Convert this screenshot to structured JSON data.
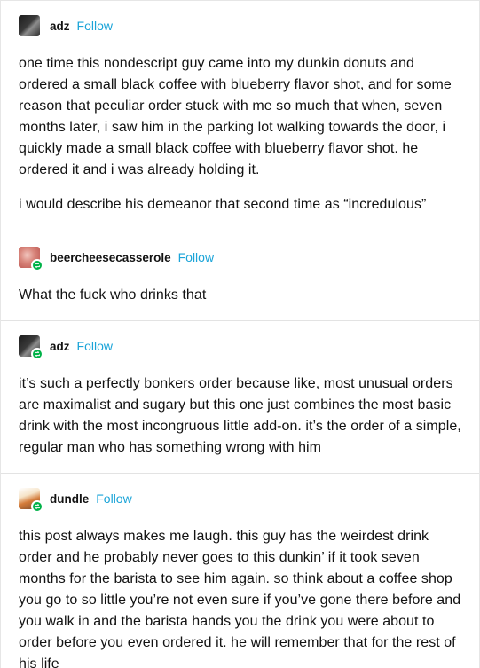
{
  "thread": [
    {
      "username": "adz",
      "follow_label": "Follow",
      "avatar_icon": "user-avatar-icon",
      "reblogged": false,
      "paragraphs": [
        "one time this nondescript guy came into my dunkin donuts and ordered a small black coffee with blueberry flavor shot, and for some reason that peculiar order stuck with me so much that when, seven months later, i saw him in the parking lot walking towards the door, i quickly made a small black coffee with blueberry flavor shot. he ordered it and i was already holding it.",
        "i would describe his demeanor that second time as “incredulous”"
      ]
    },
    {
      "username": "beercheesecasserole",
      "follow_label": "Follow",
      "avatar_icon": "user-avatar-icon",
      "reblogged": true,
      "paragraphs": [
        "What the fuck who drinks that"
      ]
    },
    {
      "username": "adz",
      "follow_label": "Follow",
      "avatar_icon": "user-avatar-icon",
      "reblogged": true,
      "paragraphs": [
        "it’s such a perfectly bonkers order because like, most unusual orders are maximalist and sugary but this one just combines the most basic drink with the most incongruous little add-on. it’s the order of a simple, regular man who has something wrong with him"
      ]
    },
    {
      "username": "dundle",
      "follow_label": "Follow",
      "avatar_icon": "user-avatar-icon",
      "reblogged": true,
      "paragraphs": [
        "this post always makes me laugh. this guy has the weirdest drink order and he probably never goes to this dunkin’ if it took seven months for the barista to see him again. so think about a coffee shop you go to so little you’re not even sure if you’ve gone there before and you walk in and the barista hands you the drink you were about to order before you even ordered it. he will remember that for the rest of his life"
      ]
    }
  ],
  "colors": {
    "follow": "#1ba4d8",
    "reblog_badge": "#00b248",
    "divider": "#e3e3e3",
    "text": "#121212"
  }
}
